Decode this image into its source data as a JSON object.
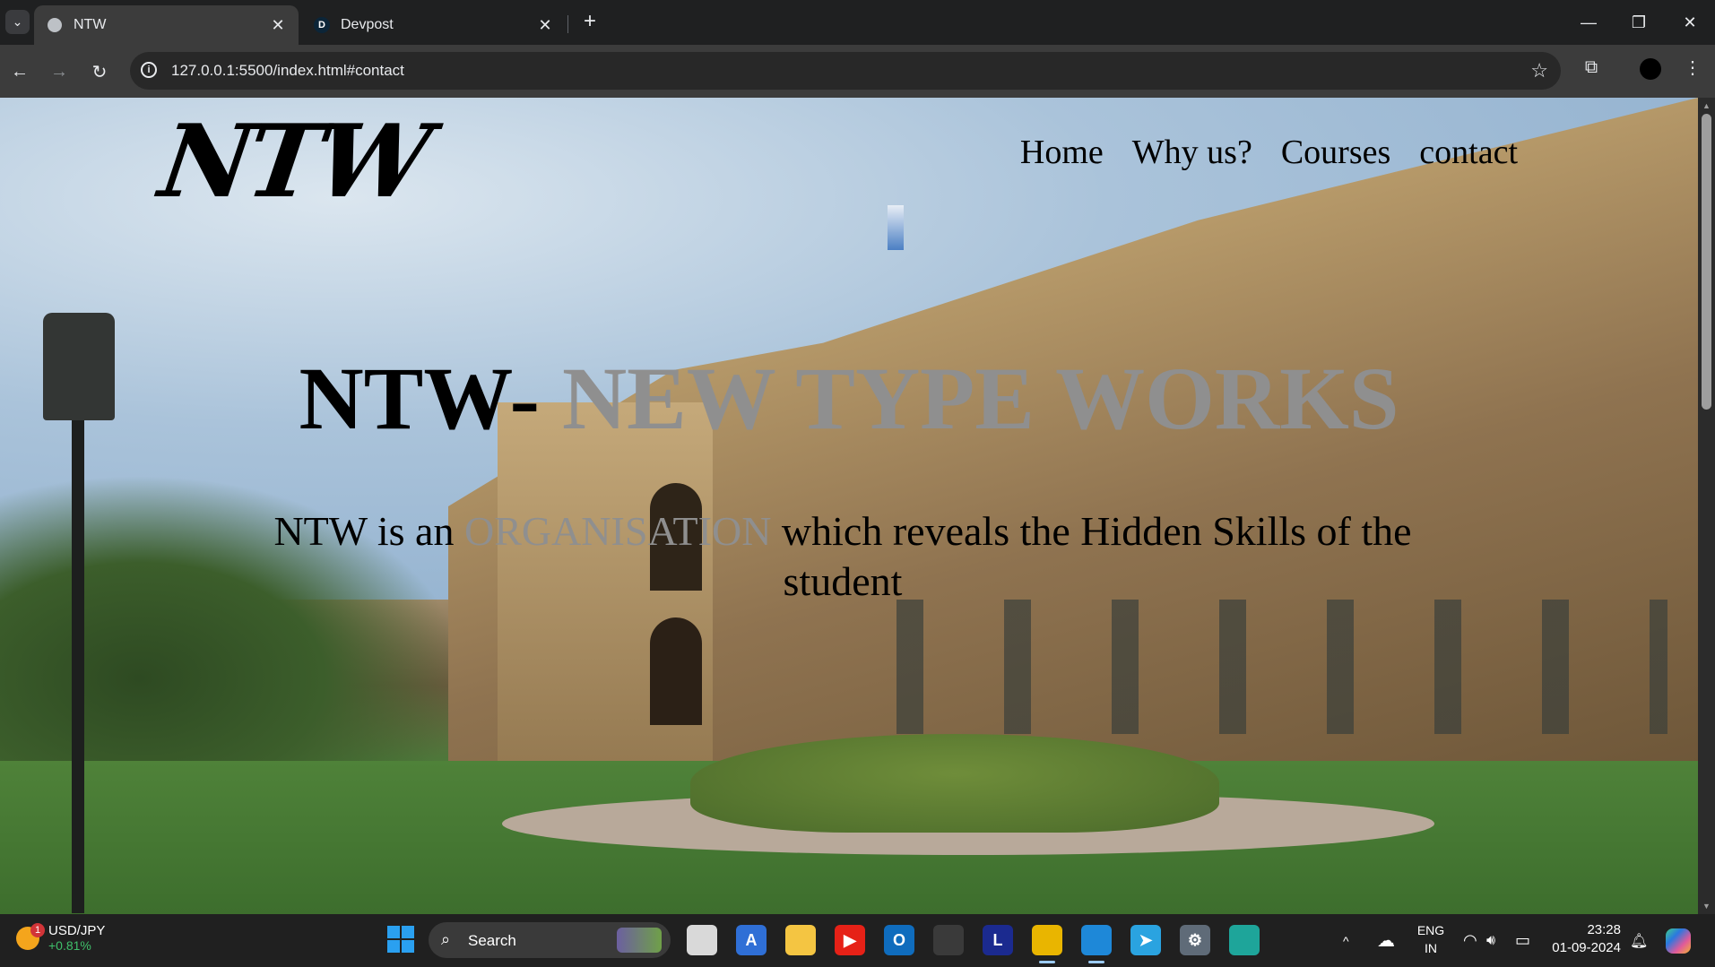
{
  "browser": {
    "tabs": [
      {
        "title": "NTW",
        "active": true,
        "icon": "globe-icon"
      },
      {
        "title": "Devpost",
        "active": false,
        "icon": "devpost-icon",
        "icon_letter": "D"
      }
    ],
    "url": "127.0.0.1:5500/index.html#contact",
    "window_controls": {
      "minimize": "—",
      "restore": "❐",
      "close": "✕"
    },
    "glyphs": {
      "tab_menu": "⌄",
      "tab_close": "✕",
      "new_tab": "+",
      "back": "←",
      "forward": "→",
      "reload": "↻",
      "info": "i",
      "star": "☆",
      "extensions": "⧉",
      "menu": "⋮"
    }
  },
  "page": {
    "logo": "NTW",
    "nav": [
      "Home",
      "Why us?",
      "Courses",
      "contact"
    ],
    "hero_title_main": "NTW-",
    "hero_title_accent": "NEW TYPE WORKS",
    "hero_sub_1": "NTW is an",
    "hero_sub_accent": "ORGANISATION",
    "hero_sub_2": "which reveals the Hidden Skills of the student"
  },
  "taskbar": {
    "ticker_symbol": "USD/JPY",
    "ticker_change": "+0.81%",
    "ticker_badge": "1",
    "search_label": "Search",
    "search_glyph": "⌕",
    "apps": [
      {
        "name": "task-view",
        "label": "",
        "color": "#d9d9d9"
      },
      {
        "name": "app-a",
        "label": "A",
        "color": "#2f6fd6"
      },
      {
        "name": "file-explorer",
        "label": "",
        "color": "#f4c542"
      },
      {
        "name": "youtube",
        "label": "▶",
        "color": "#e62117"
      },
      {
        "name": "outlook",
        "label": "O",
        "color": "#0f6cbd"
      },
      {
        "name": "ms-store",
        "label": "",
        "color": "#3a3a3a"
      },
      {
        "name": "app-l",
        "label": "L",
        "color": "#1b2a8f"
      },
      {
        "name": "chrome",
        "label": "",
        "color": "#e9b500"
      },
      {
        "name": "vscode",
        "label": "",
        "color": "#1e88d8"
      },
      {
        "name": "telegram",
        "label": "➤",
        "color": "#2aa3e0"
      },
      {
        "name": "settings",
        "label": "⚙",
        "color": "#5f6b78"
      },
      {
        "name": "edge",
        "label": "",
        "color": "#1ea59a"
      }
    ],
    "lang_1": "ENG",
    "lang_2": "IN",
    "time": "23:28",
    "date": "01-09-2024",
    "tray": {
      "chevron": "^",
      "cloud": "☁",
      "wifi": "◠",
      "volume": "🔊︎",
      "battery": "▭",
      "bell": "🔔︎"
    }
  },
  "colors": {
    "accent_grey": "#8f8f8f",
    "chrome_dark": "#1f2021",
    "taskbar": "#202020",
    "ticker_up": "#3fbf6a"
  }
}
